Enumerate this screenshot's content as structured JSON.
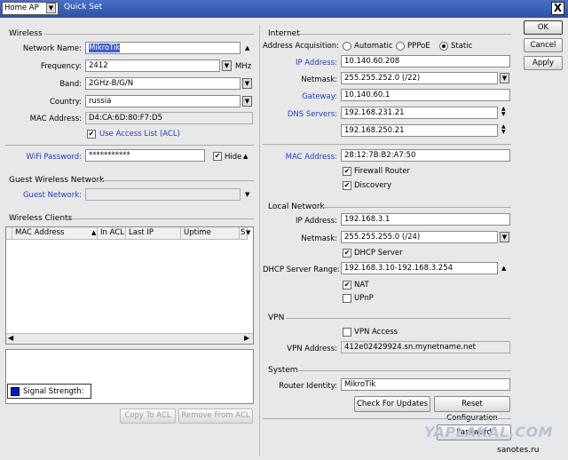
{
  "titlebar": {
    "mode": "Home AP",
    "title": "Quick Set",
    "close": "X"
  },
  "buttons": {
    "ok": "OK",
    "cancel": "Cancel",
    "apply": "Apply",
    "copy_to_acl": "Copy To ACL",
    "remove_from_acl": "Remove From ACL",
    "check_updates": "Check For Updates",
    "reset_config": "Reset Configuration",
    "password": "Password"
  },
  "wireless": {
    "title": "Wireless",
    "network_name_label": "Network Name:",
    "network_name": "MikroTik",
    "frequency_label": "Frequency:",
    "frequency": "2412",
    "frequency_unit": "MHz",
    "band_label": "Band:",
    "band": "2GHz-B/G/N",
    "country_label": "Country:",
    "country": "russia",
    "mac_label": "MAC Address:",
    "mac": "D4:CA:6D:80:F7:D5",
    "use_acl_label": "Use Access List (ACL)",
    "wifi_password_label": "WiFi Password:",
    "wifi_password": "***********",
    "hide_label": "Hide"
  },
  "guest": {
    "title": "Guest Wireless Network",
    "guest_network_label": "Guest Network:",
    "guest_network": ""
  },
  "clients": {
    "title": "Wireless Clients",
    "columns": [
      "MAC Address",
      "In ACL",
      "Last IP",
      "Uptime",
      "S"
    ],
    "signal_label": "Signal Strength:"
  },
  "internet": {
    "title": "Internet",
    "acq_label": "Address Acquisition:",
    "acq_options": [
      "Automatic",
      "PPPoE",
      "Static"
    ],
    "ip_label": "IP Address:",
    "ip": "10.140.60.208",
    "netmask_label": "Netmask:",
    "netmask": "255.255.252.0 (/22)",
    "gateway_label": "Gateway:",
    "gateway": "10.140.60.1",
    "dns_label": "DNS Servers:",
    "dns1": "192.168.231.21",
    "dns2": "192.168.250.21",
    "mac_label": "MAC Address:",
    "mac": "28:12:7B:B2:A7:50",
    "firewall_label": "Firewall Router",
    "discovery_label": "Discovery"
  },
  "local": {
    "title": "Local Network",
    "ip_label": "IP Address:",
    "ip": "192.168.3.1",
    "netmask_label": "Netmask:",
    "netmask": "255.255.255.0 (/24)",
    "dhcp_label": "DHCP Server",
    "range_label": "DHCP Server Range:",
    "range": "192.168.3.10-192.168.3.254",
    "nat_label": "NAT",
    "upnp_label": "UPnP"
  },
  "vpn": {
    "title": "VPN",
    "access_label": "VPN Access",
    "address_label": "VPN Address:",
    "address": "412e02429924.sn.mynetname.net"
  },
  "system": {
    "title": "System",
    "identity_label": "Router Identity:",
    "identity": "MikroTik"
  },
  "watermark": {
    "text": "YAPLAKAL.COM",
    "site": "sanotes.ru"
  },
  "colors": {
    "titlebar": "#2b50a8",
    "label_blue": "#1c3ec4",
    "signal": "#0018cc"
  }
}
